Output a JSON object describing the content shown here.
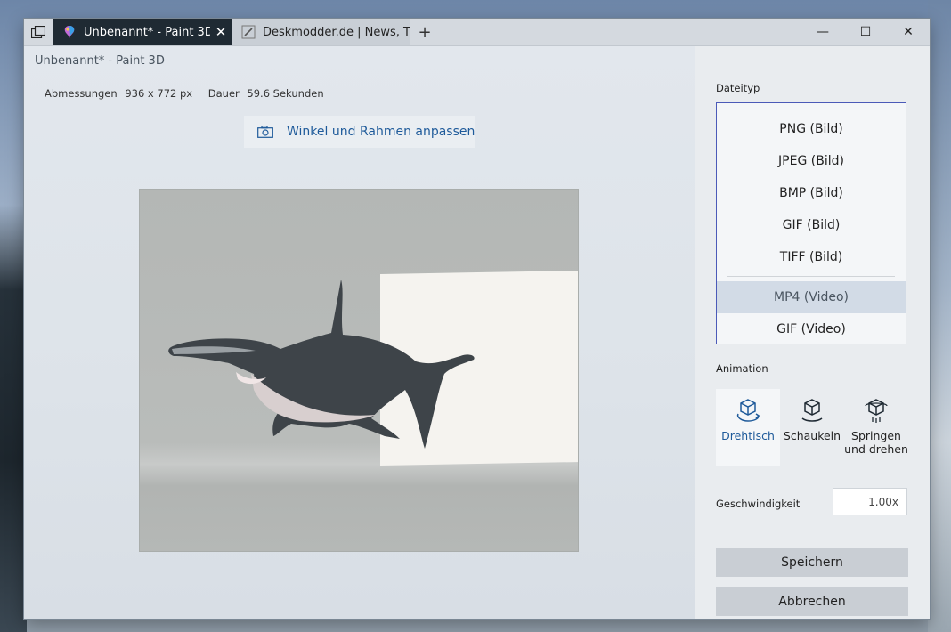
{
  "tabs": [
    {
      "label": "Unbenannt* - Paint 3D",
      "icon": "paint3d-icon",
      "active": true
    },
    {
      "label": "Deskmodder.de | News, Tipps",
      "icon": "brush-icon",
      "active": false
    }
  ],
  "window_controls": {
    "minimize": "—",
    "maximize": "☐",
    "close": "✕"
  },
  "new_tab": "+",
  "app_title": "Unbenannt* - Paint 3D",
  "dimensions": {
    "size_label": "Abmessungen",
    "size_value": "936 x 772 px",
    "duration_label": "Dauer",
    "duration_value": "59.6 Sekunden"
  },
  "adjust_button_label": "Winkel und Rahmen anpassen",
  "sidebar": {
    "filetype_label": "Dateityp",
    "filetypes": [
      "PNG (Bild)",
      "JPEG (Bild)",
      "BMP (Bild)",
      "GIF (Bild)",
      "TIFF (Bild)",
      "MP4 (Video)",
      "GIF (Video)"
    ],
    "selected_filetype": "MP4 (Video)",
    "animation_label": "Animation",
    "animations": [
      {
        "label": "Drehtisch",
        "icon": "turntable-icon",
        "active": true
      },
      {
        "label": "Schaukeln",
        "icon": "rock-icon",
        "active": false
      },
      {
        "label_line1": "Springen",
        "label_line2": "und drehen",
        "icon": "jump-spin-icon",
        "active": false
      }
    ],
    "speed_label": "Geschwindigkeit",
    "speed_value": "1.00x",
    "save_label": "Speichern",
    "cancel_label": "Abbrechen"
  },
  "colors": {
    "accent": "#1e5a9a",
    "active_tab": "#1f2a33",
    "list_border": "#4b5ab8"
  }
}
